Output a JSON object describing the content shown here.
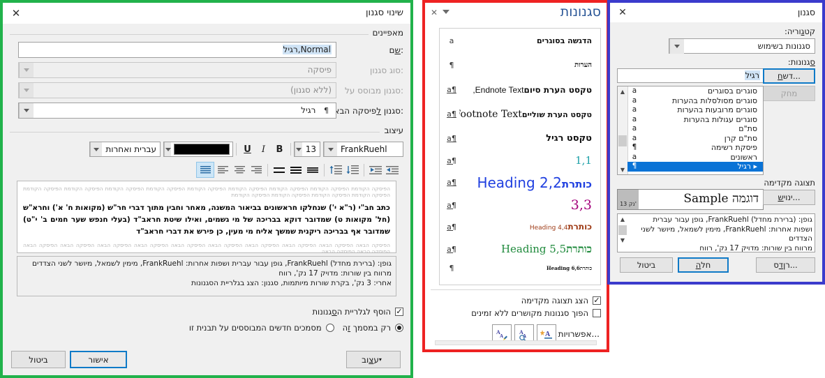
{
  "modify_style": {
    "title": "שינוי סגנון",
    "close_icon": "close-icon",
    "sections": {
      "properties": "מאפיינים",
      "formatting": "עיצוב"
    },
    "fields": [
      {
        "label": "שם:",
        "value_a": "רגיל,",
        "value_b": "Normal"
      },
      {
        "label": "סוג סגנון:",
        "value": "פיסקה"
      },
      {
        "label": "סגנון מבוסס על:",
        "value": "(ללא סגנון)"
      },
      {
        "label": "סגנון לפיסקה הבאה:",
        "value": "רגיל",
        "mark": "¶"
      }
    ],
    "font": {
      "name": "FrankRuehl",
      "size": "13",
      "color_hex": "#000000",
      "script": "עברית ואחרות"
    },
    "style_buttons": {
      "bold": "B",
      "italic": "I",
      "underline": "U"
    },
    "preview": {
      "ghost_before": "הפיסקה הקודמת הפיסקה הקודמת הפיסקה הקודמת הפיסקה הקודמת הפיסקה הקודמת הפיסקה הקודמת הפיסקה הקודמת הפיסקה הקודמת הפיסקה הקודמת הפיסקה הקודמת הפיסקה הקודמת הפיסקה הקודמת הפיסקה הקודמת",
      "body": "כתב חב\"י (ר\"א י') שנחלקו חראשונים בביאור המשנה, מאחר וחבין מתוך דברי חר\"ש (מקואות ח' א') וחרא\"ש (חל' מקואות ט) שמדובר דוקא בבריכה של מי גשמים, ואילו שיטת חראב\"ד (בעלי חנפש שער חמים ב' י\"ט) שמדובר אף בבריכה ריקנית שמשך אליח מי מעין, כן פירש את דברי חראב\"ד",
      "ghost_after": "הפיסקה הבאה הפיסקה הבאה הפיסקה הבאה הפיסקה הבאה הפיסקה הבאה הפיסקה הבאה הפיסקה הבאה הפיסקה הבאה הפיסקה הבאה הפיסקה הבאה הפיסקה הבאה הפיסקה הבאה"
    },
    "description": [
      "גופן: (ברירת מחדל) FrankRuehl, גופן עבור עברית ושפות אחרות: FrankRuehl, מימין לשמאל, מיושר לשני הצדדים",
      "מרווח בין שורות:  מדויק 17  נק', רווח",
      "אחרי:  3  נק', בקרת שורות מיותמות, סגנון: הצג בגלריית הסגנונות"
    ],
    "checkbox_gallery": {
      "label_a": "הוסף לגלריית ה",
      "label_u": "ס",
      "label_b": "גנונות",
      "checked": true
    },
    "radios": [
      {
        "label_a": "רק במסמך ",
        "label_u": "ז",
        "label_b": "ה",
        "selected": true
      },
      {
        "label_a": "מסמכים חדשים המבוססים על תבנית זו",
        "label_u": "",
        "label_b": "",
        "selected": false
      }
    ],
    "buttons": {
      "format": "עיצוב",
      "format_u": "צ",
      "ok": "אישור",
      "cancel": "ביטול"
    }
  },
  "styles_pane": {
    "title": "סגנונות",
    "close_icon": "close-icon",
    "caret_icon": "chevron-down-icon",
    "items": [
      {
        "mark": "a",
        "mark_ul": false,
        "name": "הדגשה בסוגרים",
        "css": "bold-small"
      },
      {
        "mark": "¶",
        "mark_ul": false,
        "name": "הערות",
        "css": "bold-serif-small"
      },
      {
        "mark": "¶a",
        "mark_ul": true,
        "name_latin": "Endnote Text,",
        "name": "טקסט הערת סיום",
        "css": "endnote"
      },
      {
        "mark": "¶a",
        "mark_ul": true,
        "name_latin": "Footnote Text,",
        "name": "טקסט הערת שוליים",
        "css": "footnote"
      },
      {
        "mark": "¶a",
        "mark_ul": true,
        "name": "טקסט רגיל",
        "css": "plain"
      },
      {
        "mark": "¶a",
        "mark_ul": true,
        "name": "1,1",
        "css": "h1"
      },
      {
        "mark": "¶a",
        "mark_ul": true,
        "name_latin": "Heading 2,2",
        "name": "כותרת",
        "css": "h2"
      },
      {
        "mark": "¶a",
        "mark_ul": true,
        "name": "3,3",
        "css": "h3"
      },
      {
        "mark": "¶a",
        "mark_ul": true,
        "name_latin": "Heading 4,4",
        "name": "כותרת",
        "css": "h4"
      },
      {
        "mark": "¶a",
        "mark_ul": true,
        "name_latin": "Heading 5,5",
        "name": "כותרת",
        "css": "h5"
      },
      {
        "mark": "¶",
        "mark_ul": false,
        "name_latin": "Heading 6,6",
        "name": "כותרת",
        "css": "h6"
      }
    ],
    "checkbox_preview": {
      "label": "הצג תצוגה מקדימה",
      "checked": true
    },
    "checkbox_disable": {
      "label": "הפוך סגנונות מקושרים ללא זמינים",
      "checked": false
    },
    "options_link": "אפשרויות...",
    "icon_buttons": [
      "new-style-icon",
      "style-inspector-icon",
      "manage-styles-icon"
    ]
  },
  "style_dialog": {
    "title": "סגנון",
    "close_icon": "close-icon",
    "category_label_a": "קט",
    "category_label_u": "ג",
    "category_label_b": "וריה:",
    "category_value": "סגנונות בשימוש",
    "styles_label_a": "",
    "styles_label_u": "ס",
    "styles_label_b": "גנונות:",
    "styles_value": "רגיל",
    "list": [
      {
        "icon": "a",
        "name": "סוגרים בסוגרים",
        "selected": false
      },
      {
        "icon": "a",
        "name": "סוגרים מסולסלות בהערות",
        "selected": false
      },
      {
        "icon": "a",
        "name": "סוגרים מרובעות בהערות",
        "selected": false
      },
      {
        "icon": "a",
        "name": "סוגרים עגולות בהערות",
        "selected": false
      },
      {
        "icon": "a",
        "name": "סת\"ם",
        "selected": false
      },
      {
        "icon": "a",
        "name": "סת\"ם קרן",
        "selected": false
      },
      {
        "icon": "¶",
        "name": "פיסקת רשימה",
        "selected": false
      },
      {
        "icon": "a",
        "name": "ראשונים",
        "selected": false
      },
      {
        "icon": "¶",
        "name": "רגיל",
        "selected": true,
        "prefix": "▸"
      }
    ],
    "preview_label": "תצוגה מקדימה",
    "preview_text": "דוגמה Sample",
    "preview_size": "13 נק'",
    "description": [
      "גופן: (ברירת מחדל) FrankRuehl, גופן עבור עברית",
      "ושפות אחרות: FrankRuehl, מימין לשמאל, מיושר לשני",
      "הצדדים",
      "מרווח בין שורות:  מדויק 17  נק', רווח"
    ],
    "buttons": {
      "new_a": "",
      "new_u": "ח",
      "new_b": "דש...",
      "delete": "מחק",
      "modify_a": "",
      "modify_u": "ש",
      "modify_b": "ינוי...",
      "organizer_a": "ס",
      "organizer_u": "ד",
      "organizer_b": "רן...",
      "apply_a": "",
      "apply_u": "ה",
      "apply_b": "חל",
      "cancel": "ביטול"
    }
  },
  "colors": {
    "green_border": "#21b24b",
    "red_border": "#ee2222",
    "blue_border": "#3b3bcc",
    "accent_blue": "#0f7ac7",
    "selection_blue": "#0a73d6",
    "pane_title": "#2b5797"
  }
}
